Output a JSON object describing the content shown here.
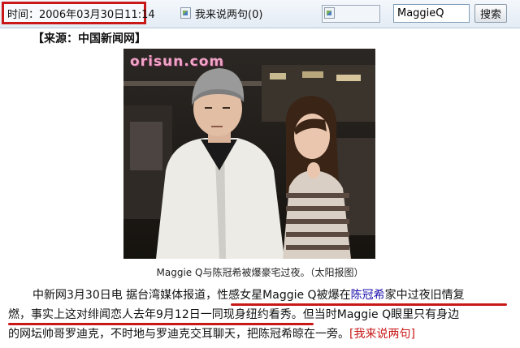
{
  "header": {
    "time_text": "时间：2006年03月30日11:14",
    "comment_link_label": "我来说两句(0)",
    "search_value": "MaggieQ",
    "search_button_label": "搜索"
  },
  "article": {
    "source_label": "【来源：中国新闻网】",
    "photo_watermark": "orisun.com",
    "photo_caption": "Maggie Q与陈冠希被爆豪宅过夜。（太阳报图）",
    "line1_prefix": "中新网3月30日电 据台湾媒体报道，",
    "line1_highlight_a": "性感女星Maggie Q被爆在",
    "line1_link": "陈冠希",
    "line1_highlight_b": "家中过夜旧情复",
    "line2_highlight": "燃，事实上这对绯闻恋人去年9月12日一同现身纽约看秀。",
    "line2_suffix": "但当时Maggie Q眼里只有身边",
    "line3_text": "的网坛帅哥罗迪克，不时地与罗迪克交耳聊天，把陈冠希晾在一旁。",
    "line3_link": "[我来说两句]"
  },
  "colors": {
    "highlight_red": "#c81818",
    "link_blue": "#1a0dab",
    "toolbar_bg": "#e3ebf4"
  }
}
